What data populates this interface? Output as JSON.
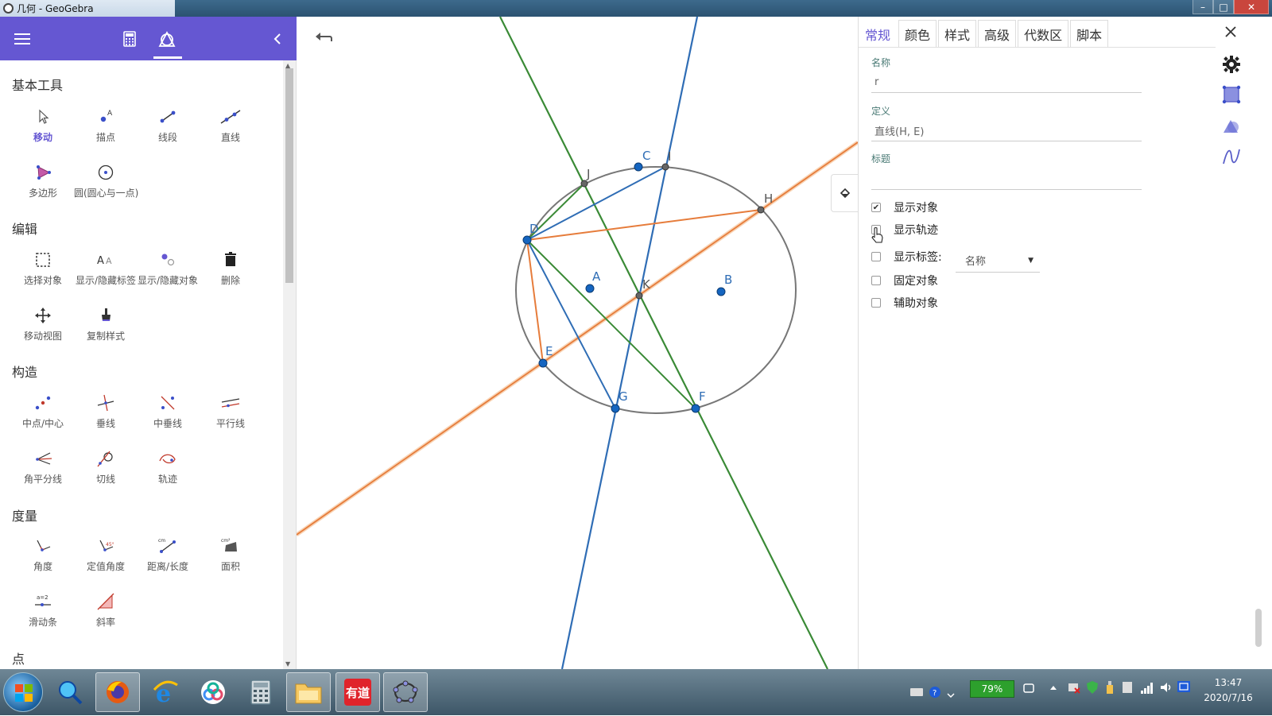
{
  "window": {
    "title": "几何 - GeoGebra",
    "controls": [
      "–",
      "□",
      "✕"
    ]
  },
  "toolbar_header": {
    "menu_icon": "hamburger-icon",
    "tabs": [
      "calculator-icon",
      "geometry-icon"
    ],
    "collapse_icon": "chevron-left-icon"
  },
  "tool_sections": [
    {
      "title": "基本工具",
      "tools": [
        "移动",
        "描点",
        "线段",
        "直线",
        "多边形",
        "圆(圆心与一点)"
      ]
    },
    {
      "title": "编辑",
      "tools": [
        "选择对象",
        "显示/隐藏标签",
        "显示/隐藏对象",
        "删除",
        "移动视图",
        "复制样式"
      ]
    },
    {
      "title": "构造",
      "tools": [
        "中点/中心",
        "垂线",
        "中垂线",
        "平行线",
        "角平分线",
        "切线",
        "轨迹"
      ]
    },
    {
      "title": "度量",
      "tools": [
        "角度",
        "定值角度",
        "距离/长度",
        "面积",
        "滑动条",
        "斜率"
      ]
    },
    {
      "title": "点",
      "tools": []
    }
  ],
  "graphics": {
    "undo_icon": "undo-icon",
    "point_labels": {
      "A": "A",
      "B": "B",
      "C": "C",
      "D": "D",
      "E": "E",
      "F": "F",
      "G": "G",
      "H": "H",
      "I": "I",
      "J": "J",
      "K": "K"
    },
    "colors": {
      "circle": "#777777",
      "blue": "#2f6db5",
      "green": "#3a8a36",
      "orange": "#e67c3b",
      "point": "#1565c0"
    }
  },
  "properties": {
    "tabs": [
      "常规",
      "颜色",
      "样式",
      "高级",
      "代数区",
      "脚本"
    ],
    "active_tab": "常规",
    "name_label": "名称",
    "name_value": "r",
    "definition_label": "定义",
    "definition_value": "直线(H, E)",
    "caption_label": "标题",
    "caption_value": "",
    "checkboxes": [
      {
        "label": "显示对象",
        "checked": true
      },
      {
        "label": "显示轨迹",
        "checked": false
      },
      {
        "label": "显示标签:",
        "checked": false
      },
      {
        "label": "固定对象",
        "checked": false
      },
      {
        "label": "辅助对象",
        "checked": false
      }
    ],
    "label_select_value": "名称",
    "close_icon": "close-icon",
    "side_icons": [
      "settings-icon",
      "graphics-view-icon",
      "geometry-shapes-icon",
      "function-icon"
    ]
  },
  "taskbar": {
    "apps": [
      "magnifier-search-icon",
      "firefox-icon",
      "internet-explorer-icon",
      "cloud-drive-icon",
      "calculator-icon",
      "file-explorer-icon",
      "youdao-icon",
      "geogebra-icon"
    ],
    "youdao_label": "有道",
    "battery": "79%",
    "time": "13:47",
    "date": "2020/7/16"
  }
}
